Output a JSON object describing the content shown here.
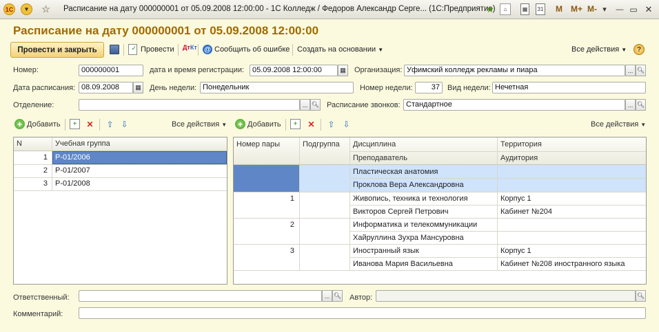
{
  "window": {
    "title": "Расписание на дату 000000001 от 05.09.2008 12:00:00 - 1С Колледж / Федоров Александр Серге... (1С:Предприятие)",
    "memory_buttons": [
      "M",
      "M+",
      "M-"
    ]
  },
  "document": {
    "title": "Расписание на дату 000000001 от 05.09.2008 12:00:00"
  },
  "toolbar": {
    "post_close": "Провести и закрыть",
    "post": "Провести",
    "report_error": "Сообщить об ошибке",
    "create_based": "Создать на основании",
    "all_actions": "Все действия",
    "help": "?"
  },
  "form": {
    "number_label": "Номер:",
    "number": "000000001",
    "reg_datetime_label": "дата и время регистрации:",
    "reg_datetime": "05.09.2008 12:00:00",
    "organization_label": "Организация:",
    "organization": "Уфимский колледж рекламы и пиара",
    "schedule_date_label": "Дата расписания:",
    "schedule_date": "08.09.2008",
    "weekday_label": "День недели:",
    "weekday": "Понедельник",
    "week_number_label": "Номер недели:",
    "week_number": "37",
    "week_type_label": "Вид недели:",
    "week_type": "Нечетная",
    "department_label": "Отделение:",
    "department": "",
    "bells_label": "Расписание звонков:",
    "bells": "Стандартное",
    "responsible_label": "Ответственный:",
    "responsible": "",
    "author_label": "Автор:",
    "author": "",
    "comment_label": "Комментарий:",
    "comment": ""
  },
  "groups_panel": {
    "add": "Добавить",
    "all_actions": "Все действия",
    "columns": [
      "N",
      "Учебная группа"
    ],
    "rows": [
      {
        "n": "1",
        "group": "Р-01/2006"
      },
      {
        "n": "2",
        "group": "Р-01/2007"
      },
      {
        "n": "3",
        "group": "Р-01/2008"
      }
    ]
  },
  "lessons_panel": {
    "add": "Добавить",
    "all_actions": "Все действия",
    "columns": {
      "pair": "Номер пары",
      "subgroup": "Подгруппа",
      "discipline": "Дисциплина",
      "teacher": "Преподаватель",
      "territory": "Территория",
      "room": "Аудитория"
    },
    "rows": [
      {
        "pair": "",
        "subgroup": "",
        "discipline": "Пластическая анатомия",
        "teacher": "Проклова Вера Александровна",
        "territory": "",
        "room": ""
      },
      {
        "pair": "1",
        "subgroup": "",
        "discipline": "Живопись, техника и технология",
        "teacher": "Викторов Сергей Петрович",
        "territory": "Корпус 1",
        "room": "Кабинет №204"
      },
      {
        "pair": "2",
        "subgroup": "",
        "discipline": "Информатика и телекоммуникации",
        "teacher": "Хайруллина Зухра Мансуровна",
        "territory": "",
        "room": ""
      },
      {
        "pair": "3",
        "subgroup": "",
        "discipline": "Иностранный язык",
        "teacher": "Иванова Мария Васильевна",
        "territory": "Корпус 1",
        "room": "Кабинет №208 иностранного языка"
      }
    ]
  },
  "colors": {
    "title": "#a06a00",
    "selection": "#5f86c6",
    "row_highlight": "#cfe3fb"
  }
}
